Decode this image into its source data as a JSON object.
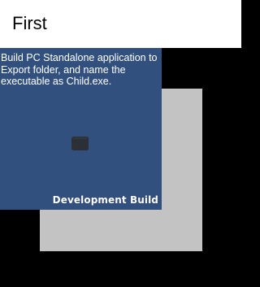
{
  "window": {
    "title": "First"
  },
  "panel": {
    "instruction_text": "Build PC Standalone application to Export folder, and name the executable as Child.exe.",
    "badge": "Development Build",
    "icon": "unity-cube-icon"
  },
  "colors": {
    "titlebar_bg": "#ffffff",
    "viewport_bg": "#000000",
    "gray_square": "#c3c3c3",
    "panel_bg": "#32507e",
    "icon_fill": "#2b2f36"
  }
}
